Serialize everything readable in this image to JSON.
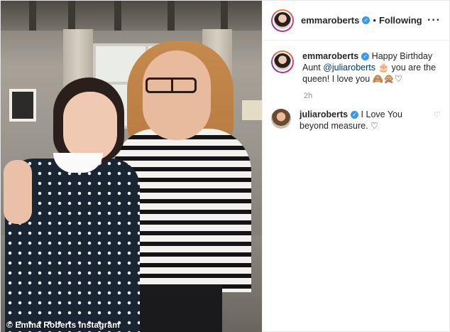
{
  "post": {
    "credit": "© Emma Roberts Instagram"
  },
  "header": {
    "username": "emmaroberts",
    "verified_glyph": "✓",
    "separator": "•",
    "follow_label": "Following",
    "more_label": "···",
    "more_icon": "more-options-icon"
  },
  "caption": {
    "username": "emmaroberts",
    "text_before": " Happy Birthday Aunt ",
    "mention": "@juliaroberts",
    "text_after": " 🎂 you are the queen! I love you 🙈🙊♡",
    "time": "2h"
  },
  "comment": {
    "username": "juliaroberts",
    "text": " I Love You beyond measure. ♡",
    "like_icon": "♡"
  },
  "colors": {
    "verified": "#3897f0",
    "mention": "#003569",
    "muted": "#8e8e8e"
  }
}
